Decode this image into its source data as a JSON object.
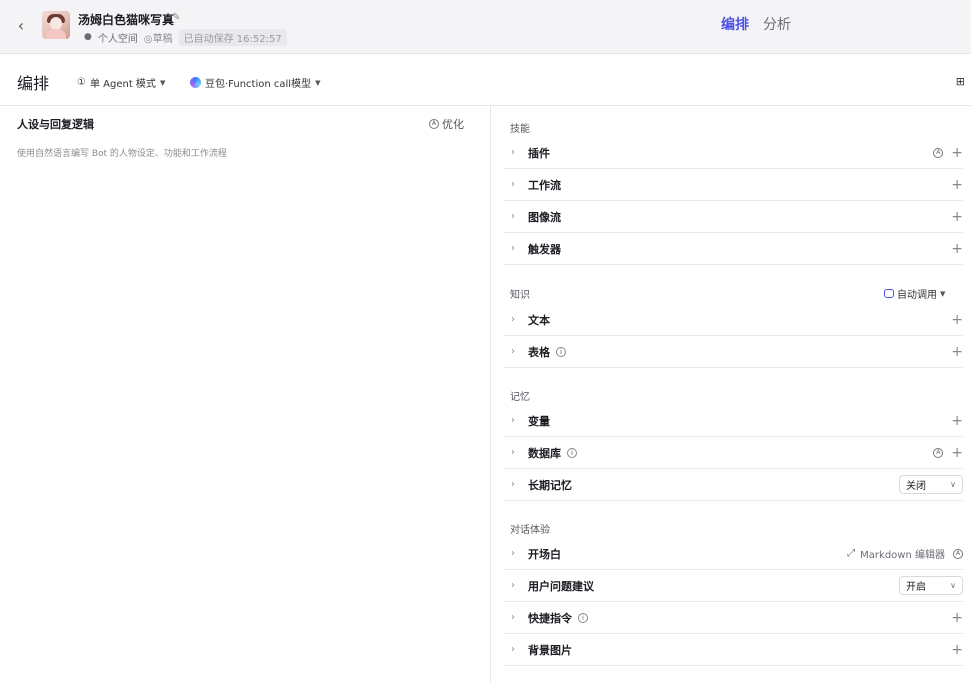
{
  "header": {
    "bot_name": "汤姆白色猫咪写真",
    "workspace": "个人空间",
    "draft": "◎草稿",
    "saved_at": "已自动保存 16:52:57",
    "tabs": [
      {
        "label": "编排",
        "active": true
      },
      {
        "label": "分析",
        "active": false
      }
    ],
    "accent_color": "#4d53e8"
  },
  "toolbar": {
    "title": "编排",
    "agent_mode": "单 Agent 模式",
    "model": "豆包·Function call模型"
  },
  "persona": {
    "title": "人设与回复逻辑",
    "optimize_label": "优化",
    "placeholder": "使用自然语言编写 Bot 的人物设定、功能和工作流程"
  },
  "skills": {
    "title": "技能",
    "items": [
      {
        "label": "插件",
        "auto": true
      },
      {
        "label": "工作流"
      },
      {
        "label": "图像流"
      },
      {
        "label": "触发器"
      }
    ]
  },
  "knowledge": {
    "title": "知识",
    "auto_call_label": "自动调用",
    "items": [
      {
        "label": "文本"
      },
      {
        "label": "表格",
        "info": true
      }
    ]
  },
  "memory": {
    "title": "记忆",
    "items": [
      {
        "label": "变量"
      },
      {
        "label": "数据库",
        "info": true,
        "auto": true
      },
      {
        "label": "长期记忆",
        "select_value": "关闭"
      }
    ]
  },
  "dialog": {
    "title": "对话体验",
    "items": [
      {
        "label": "开场白",
        "editor_label": "Markdown 编辑器"
      },
      {
        "label": "用户问题建议",
        "select_value": "开启"
      },
      {
        "label": "快捷指令",
        "info": true
      },
      {
        "label": "背景图片"
      }
    ]
  }
}
